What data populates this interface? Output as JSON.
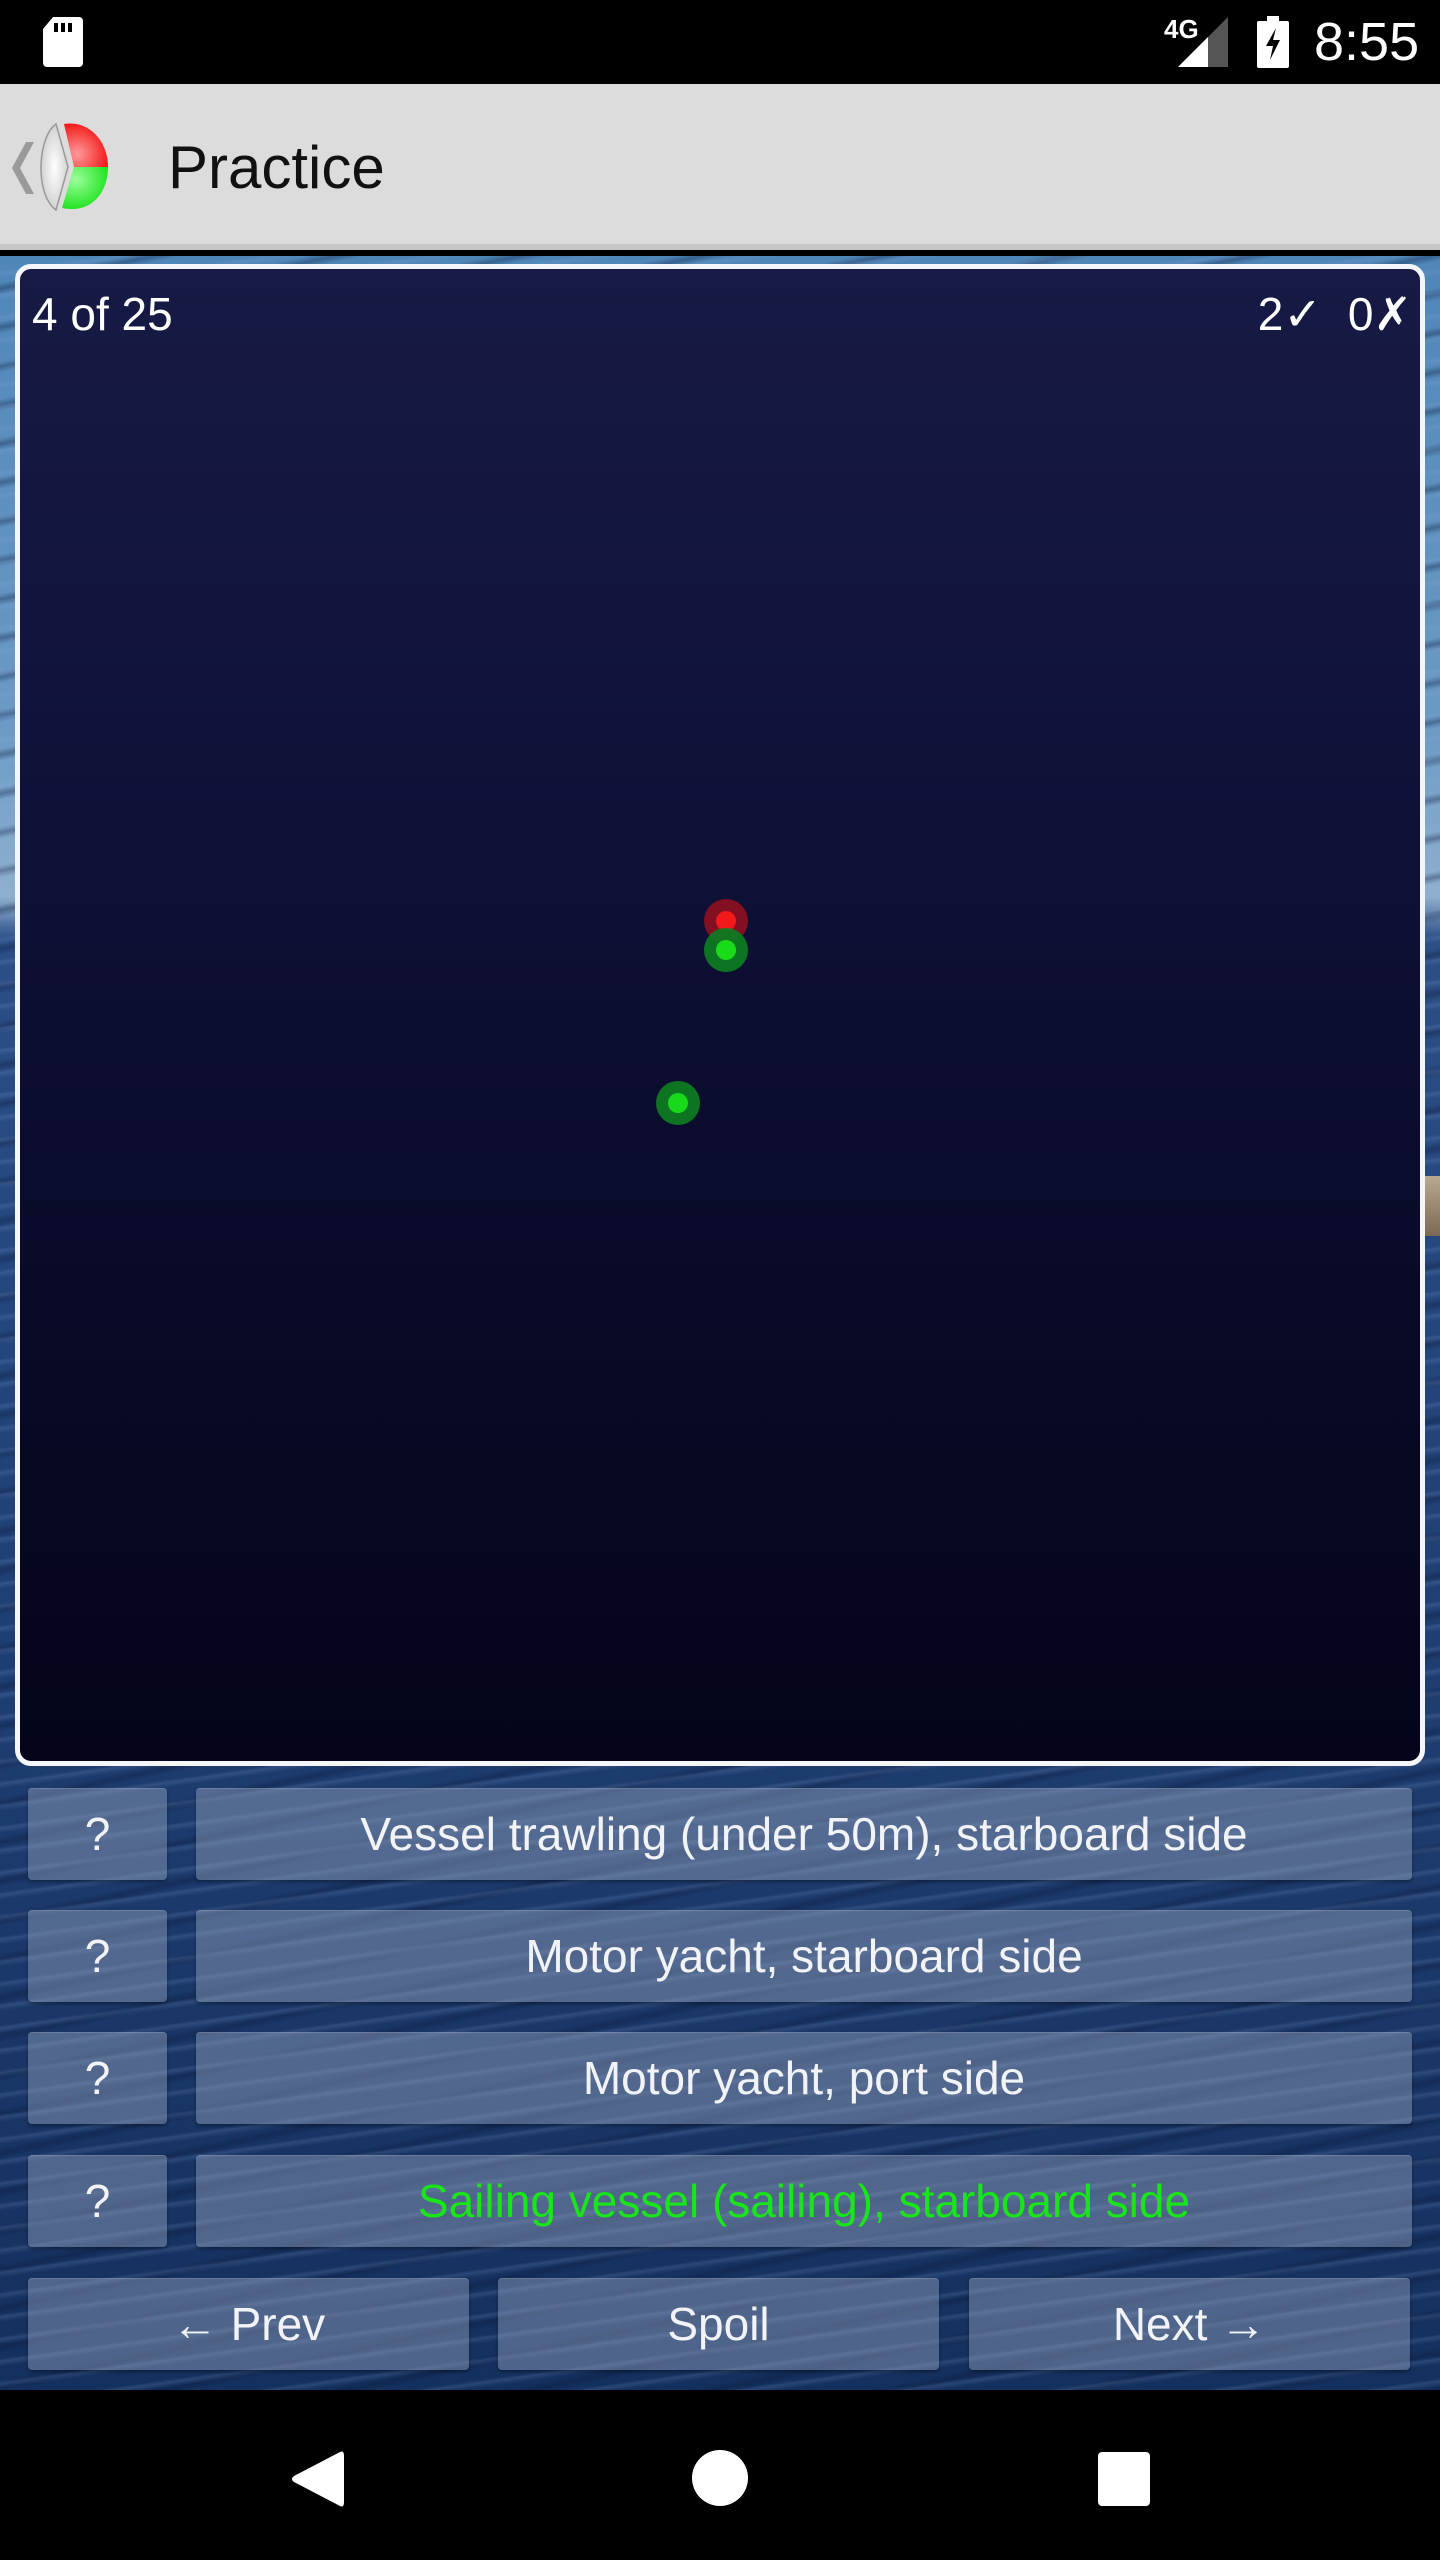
{
  "status_bar": {
    "left_icons": [
      "sd-card-icon"
    ],
    "network_label": "4G",
    "right_icons": [
      "signal-icon",
      "battery-charging-icon"
    ],
    "time": "8:55"
  },
  "app_bar": {
    "title": "Practice",
    "back_icon": "chevron-left-icon",
    "logo_icon": "navigation-lights-logo-icon"
  },
  "quiz": {
    "progress": "4 of 25",
    "correct_count": "2",
    "correct_mark": "✓",
    "wrong_count": "0",
    "wrong_mark": "✗",
    "lights": [
      {
        "color": "red",
        "hex": "#ff1a1a",
        "halo": "#8a0f22"
      },
      {
        "color": "green",
        "hex": "#19e619",
        "halo": "#0e7a22"
      },
      {
        "color": "green",
        "hex": "#19e619",
        "halo": "#0e7a22"
      }
    ]
  },
  "answers": [
    {
      "hint_label": "?",
      "label": "Vessel trawling (under 50m), starboard side",
      "state": "normal"
    },
    {
      "hint_label": "?",
      "label": "Motor yacht, starboard side",
      "state": "normal"
    },
    {
      "hint_label": "?",
      "label": "Motor yacht, port side",
      "state": "normal"
    },
    {
      "hint_label": "?",
      "label": "Sailing vessel (sailing), starboard side",
      "state": "correct"
    }
  ],
  "navigation": {
    "prev_label": "← Prev",
    "spoil_label": "Spoil",
    "next_label": "Next →"
  },
  "colors": {
    "correct_answer": "#19e619",
    "app_bar": "#dcdcdc",
    "card_border": "#f4f6fa"
  },
  "system_nav": {
    "back_icon": "triangle-back-icon",
    "home_icon": "circle-home-icon",
    "recents_icon": "square-recents-icon"
  }
}
